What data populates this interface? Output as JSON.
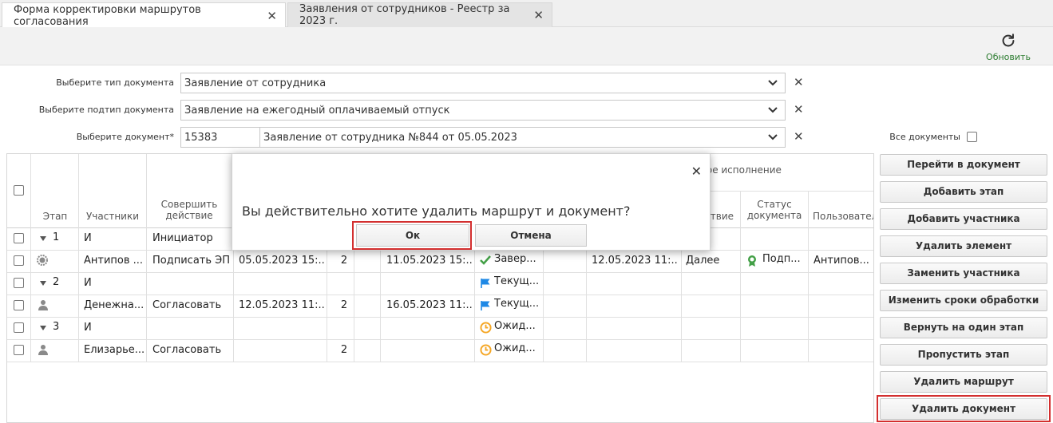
{
  "tabs": [
    {
      "label": "Форма корректировки маршрутов согласования",
      "close": "✕"
    },
    {
      "label": "Заявления от сотрудников - Реестр за 2023 г.",
      "close": "✕"
    }
  ],
  "toolbar": {
    "refresh_label": "Обновить"
  },
  "filters": {
    "doc_type": {
      "label": "Выберите тип документа",
      "value": "Заявление от сотрудника"
    },
    "doc_subtype": {
      "label": "Выберите подтип документа",
      "value": "Заявление на ежегодный оплачиваемый отпуск"
    },
    "doc": {
      "label": "Выберите документ*",
      "id": "15383",
      "value": "Заявление от сотрудника №844 от 05.05.2023"
    },
    "all_docs_label": "Все документы"
  },
  "grid": {
    "headers": {
      "stage": "Этап",
      "participants": "Участники",
      "action": "Совершить действие",
      "exec_group": "ское исполнение",
      "action2": "ствие",
      "doc_status": "Статус документа",
      "user": "Пользовател"
    },
    "rows": [
      {
        "stage": "1",
        "participant": "И",
        "action": "Инициатор",
        "received": "",
        "n": "",
        "deadline": "",
        "status": "",
        "completed": "",
        "action2": "",
        "doc_status": "",
        "user": ""
      },
      {
        "stage": "",
        "participant": "Антипов ...",
        "action": "Подписать ЭП",
        "received": "05.05.2023 15:...",
        "n": "2",
        "deadline": "11.05.2023 15:...",
        "status": "Завер...",
        "completed": "12.05.2023 11:...",
        "action2": "Далее",
        "doc_status": "Подп...",
        "user": "Антипов..."
      },
      {
        "stage": "2",
        "participant": "И",
        "action": "",
        "received": "",
        "n": "",
        "deadline": "",
        "status": "Текущ...",
        "completed": "",
        "action2": "",
        "doc_status": "",
        "user": ""
      },
      {
        "stage": "",
        "participant": "Денежна...",
        "action": "Согласовать",
        "received": "12.05.2023 11:...",
        "n": "2",
        "deadline": "16.05.2023 11:...",
        "status": "Текущ...",
        "completed": "",
        "action2": "",
        "doc_status": "",
        "user": ""
      },
      {
        "stage": "3",
        "participant": "И",
        "action": "",
        "received": "",
        "n": "",
        "deadline": "",
        "status": "Ожид...",
        "completed": "",
        "action2": "",
        "doc_status": "",
        "user": ""
      },
      {
        "stage": "",
        "participant": "Елизарье...",
        "action": "Согласовать",
        "received": "",
        "n": "2",
        "deadline": "",
        "status": "Ожид...",
        "completed": "",
        "action2": "",
        "doc_status": "",
        "user": ""
      }
    ]
  },
  "side_buttons": [
    "Перейти в документ",
    "Добавить этап",
    "Добавить участника",
    "Удалить элемент",
    "Заменить участника",
    "Изменить сроки обработки",
    "Вернуть на один этап",
    "Пропустить этап",
    "Удалить маршрут",
    "Удалить документ"
  ],
  "dialog": {
    "message": "Вы действительно хотите удалить маршрут и документ?",
    "ok": "Ок",
    "cancel": "Отмена",
    "close": "✕"
  },
  "colors": {
    "highlight": "#d32f2f",
    "refresh_green": "#2e7d32",
    "status_blue": "#1e88e5",
    "status_orange": "#f5a623",
    "status_green": "#43a047"
  }
}
